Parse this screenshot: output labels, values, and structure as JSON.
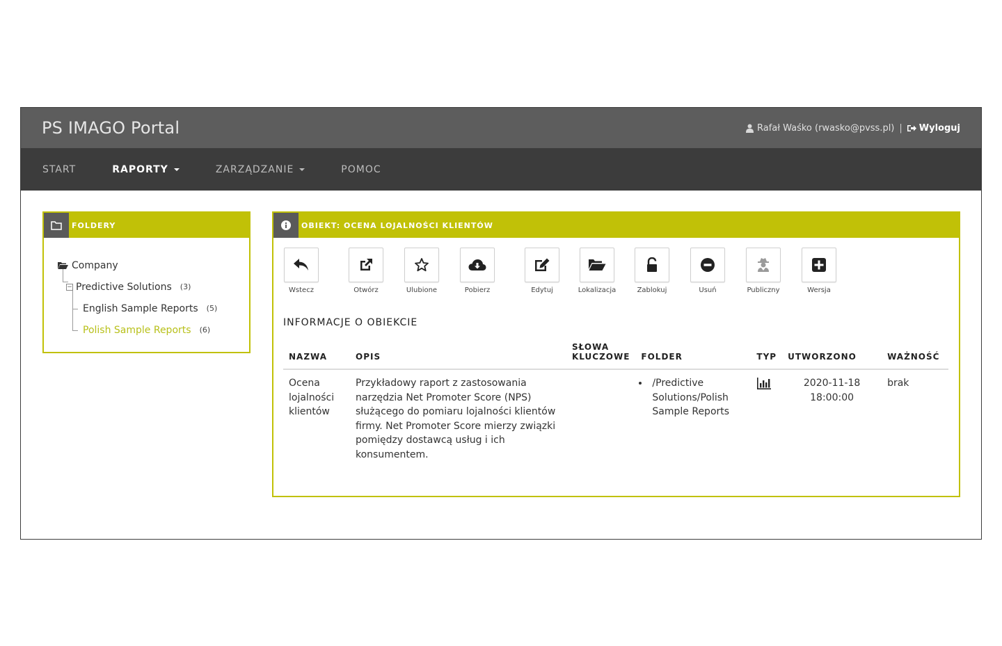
{
  "header": {
    "app_title": "PS IMAGO Portal",
    "user_label": "Rafał Waśko (rwasko@pvss.pl)",
    "separator": "|",
    "logout_label": "Wyloguj"
  },
  "nav": {
    "items": [
      {
        "label": "START",
        "active": false,
        "dropdown": false
      },
      {
        "label": "RAPORTY",
        "active": true,
        "dropdown": true
      },
      {
        "label": "ZARZĄDZANIE",
        "active": false,
        "dropdown": true
      },
      {
        "label": "POMOC",
        "active": false,
        "dropdown": false
      }
    ]
  },
  "folders": {
    "panel_title": "FOLDERY",
    "tree": [
      {
        "label": "Company",
        "count": ""
      },
      {
        "label": "Predictive Solutions",
        "count": "(3)"
      },
      {
        "label": "English Sample Reports",
        "count": "(5)"
      },
      {
        "label": "Polish Sample Reports",
        "count": "(6)"
      }
    ]
  },
  "object": {
    "panel_title": "OBIEKT: OCENA LOJALNOŚCI KLIENTÓW",
    "toolbar": [
      {
        "label": "Wstecz",
        "icon": "reply-icon"
      },
      {
        "label": "Otwórz",
        "icon": "external-link-icon"
      },
      {
        "label": "Ulubione",
        "icon": "star-icon"
      },
      {
        "label": "Pobierz",
        "icon": "cloud-download-icon"
      },
      {
        "label": "Edytuj",
        "icon": "edit-icon"
      },
      {
        "label": "Lokalizacja",
        "icon": "folder-open-icon"
      },
      {
        "label": "Zablokuj",
        "icon": "unlock-icon"
      },
      {
        "label": "Usuń",
        "icon": "minus-circle-icon"
      },
      {
        "label": "Publiczny",
        "icon": "user-secret-icon"
      },
      {
        "label": "Wersja",
        "icon": "plus-square-icon"
      }
    ],
    "info_title": "INFORMACJE O OBIEKCIE",
    "columns": {
      "name": "NAZWA",
      "desc": "OPIS",
      "keywords_line1": "SŁOWA",
      "keywords_line2": "KLUCZOWE",
      "folder": "FOLDER",
      "type": "TYP",
      "created": "UTWORZONO",
      "validity": "WAŻNOŚĆ"
    },
    "row": {
      "name_lines": [
        "Ocena",
        "lojalności",
        "klientów"
      ],
      "desc_lines": [
        "Przykładowy raport z zastosowania",
        "narzędzia Net Promoter Score (NPS)",
        "służącego do pomiaru lojalności klientów",
        "firmy. Net Promoter Score mierzy związki",
        "pomiędzy dostawcą usług i ich",
        "konsumentem."
      ],
      "keywords": "",
      "folder_lines": [
        "/Predictive",
        "Solutions/Polish",
        "Sample Reports"
      ],
      "type_icon": "bar-chart-icon",
      "created_lines": [
        "2020-11-18",
        "18:00:00"
      ],
      "validity": "brak"
    }
  },
  "colors": {
    "accent": "#c1c107",
    "topbar": "#5d5d5d",
    "navbar": "#3c3c3c",
    "active_tree": "#b8c01a"
  }
}
